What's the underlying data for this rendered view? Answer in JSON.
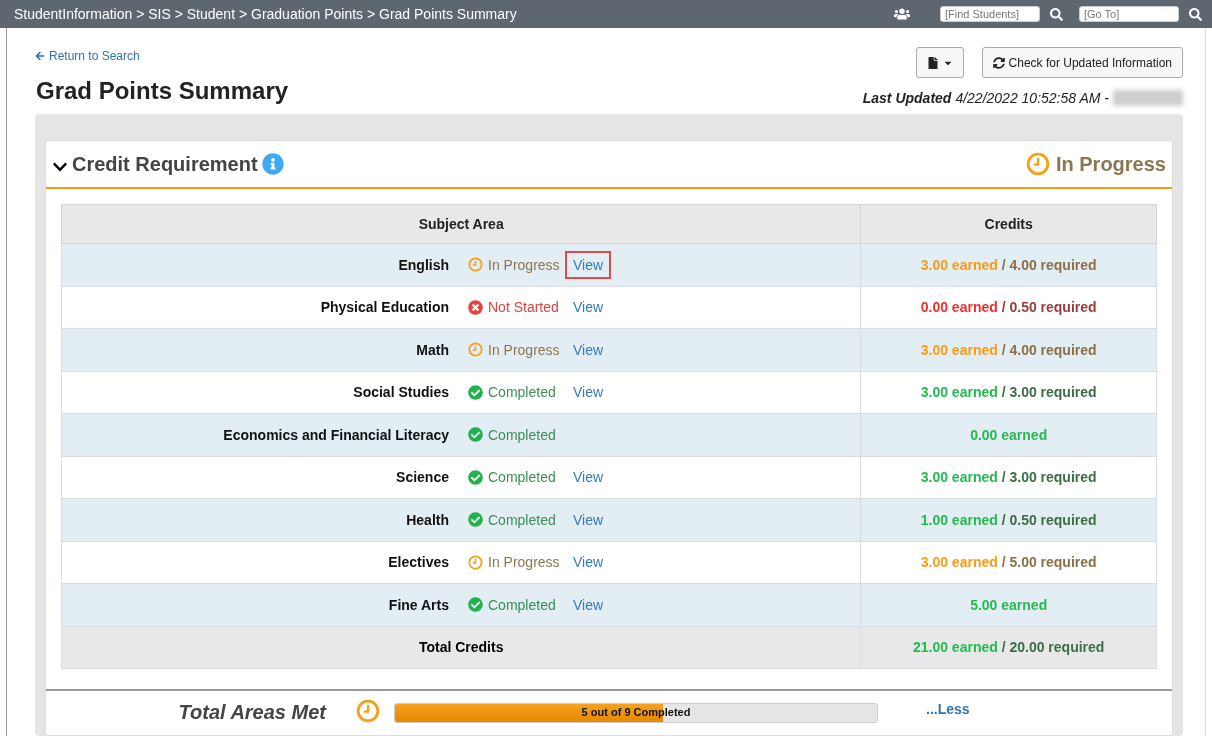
{
  "breadcrumb": "StudentInformation > SIS > Student > Graduation Points > Grad Points Summary",
  "top_search": {
    "placeholder": "[Find Students]"
  },
  "top_goto": {
    "placeholder": "[Go To]"
  },
  "return_link": "Return to Search",
  "title": "Grad Points Summary",
  "check_button": "Check for Updated Information",
  "last_updated": {
    "label": "Last Updated",
    "value": "4/22/2022 10:52:58 AM -"
  },
  "section": {
    "title": "Credit Requirement",
    "expanded": true,
    "status": {
      "kind": "in_progress",
      "label": "In Progress"
    }
  },
  "table": {
    "columns": [
      "Subject Area",
      "Credits"
    ],
    "rows": [
      {
        "subject": "English",
        "status": {
          "kind": "in_progress",
          "label": "In Progress"
        },
        "link": "View",
        "highlighted": true,
        "earned": "3.00 earned",
        "required": " / 4.00 required"
      },
      {
        "subject": "Physical Education",
        "status": {
          "kind": "not_started",
          "label": "Not Started"
        },
        "link": "View",
        "highlighted": false,
        "earned": "0.00 earned",
        "required": " / 0.50 required"
      },
      {
        "subject": "Math",
        "status": {
          "kind": "in_progress",
          "label": "In Progress"
        },
        "link": "View",
        "highlighted": false,
        "earned": "3.00 earned",
        "required": " / 4.00 required"
      },
      {
        "subject": "Social Studies",
        "status": {
          "kind": "completed",
          "label": "Completed"
        },
        "link": "View",
        "highlighted": false,
        "earned": "3.00 earned",
        "required": " / 3.00 required"
      },
      {
        "subject": "Economics and Financial Literacy",
        "status": {
          "kind": "completed",
          "label": "Completed"
        },
        "earned": "0.00 earned"
      },
      {
        "subject": "Science",
        "status": {
          "kind": "completed",
          "label": "Completed"
        },
        "link": "View",
        "highlighted": false,
        "earned": "3.00 earned",
        "required": " / 3.00 required"
      },
      {
        "subject": "Health",
        "status": {
          "kind": "completed",
          "label": "Completed"
        },
        "link": "View",
        "highlighted": false,
        "earned": "1.00 earned",
        "required": " / 0.50 required"
      },
      {
        "subject": "Electives",
        "status": {
          "kind": "in_progress",
          "label": "In Progress"
        },
        "link": "View",
        "highlighted": false,
        "earned": "3.00 earned",
        "required": " / 5.00 required"
      },
      {
        "subject": "Fine Arts",
        "status": {
          "kind": "completed",
          "label": "Completed"
        },
        "link": "View",
        "highlighted": false,
        "earned": "5.00 earned"
      }
    ],
    "total": {
      "label": "Total Credits",
      "status": {
        "kind": "completed"
      },
      "earned": "21.00 earned",
      "required": " / 20.00 required"
    }
  },
  "summary": {
    "label": "Total Areas Met",
    "status": {
      "kind": "in_progress"
    },
    "level": 0.556,
    "text": "5 out of 9 Completed",
    "link": "...Less"
  }
}
